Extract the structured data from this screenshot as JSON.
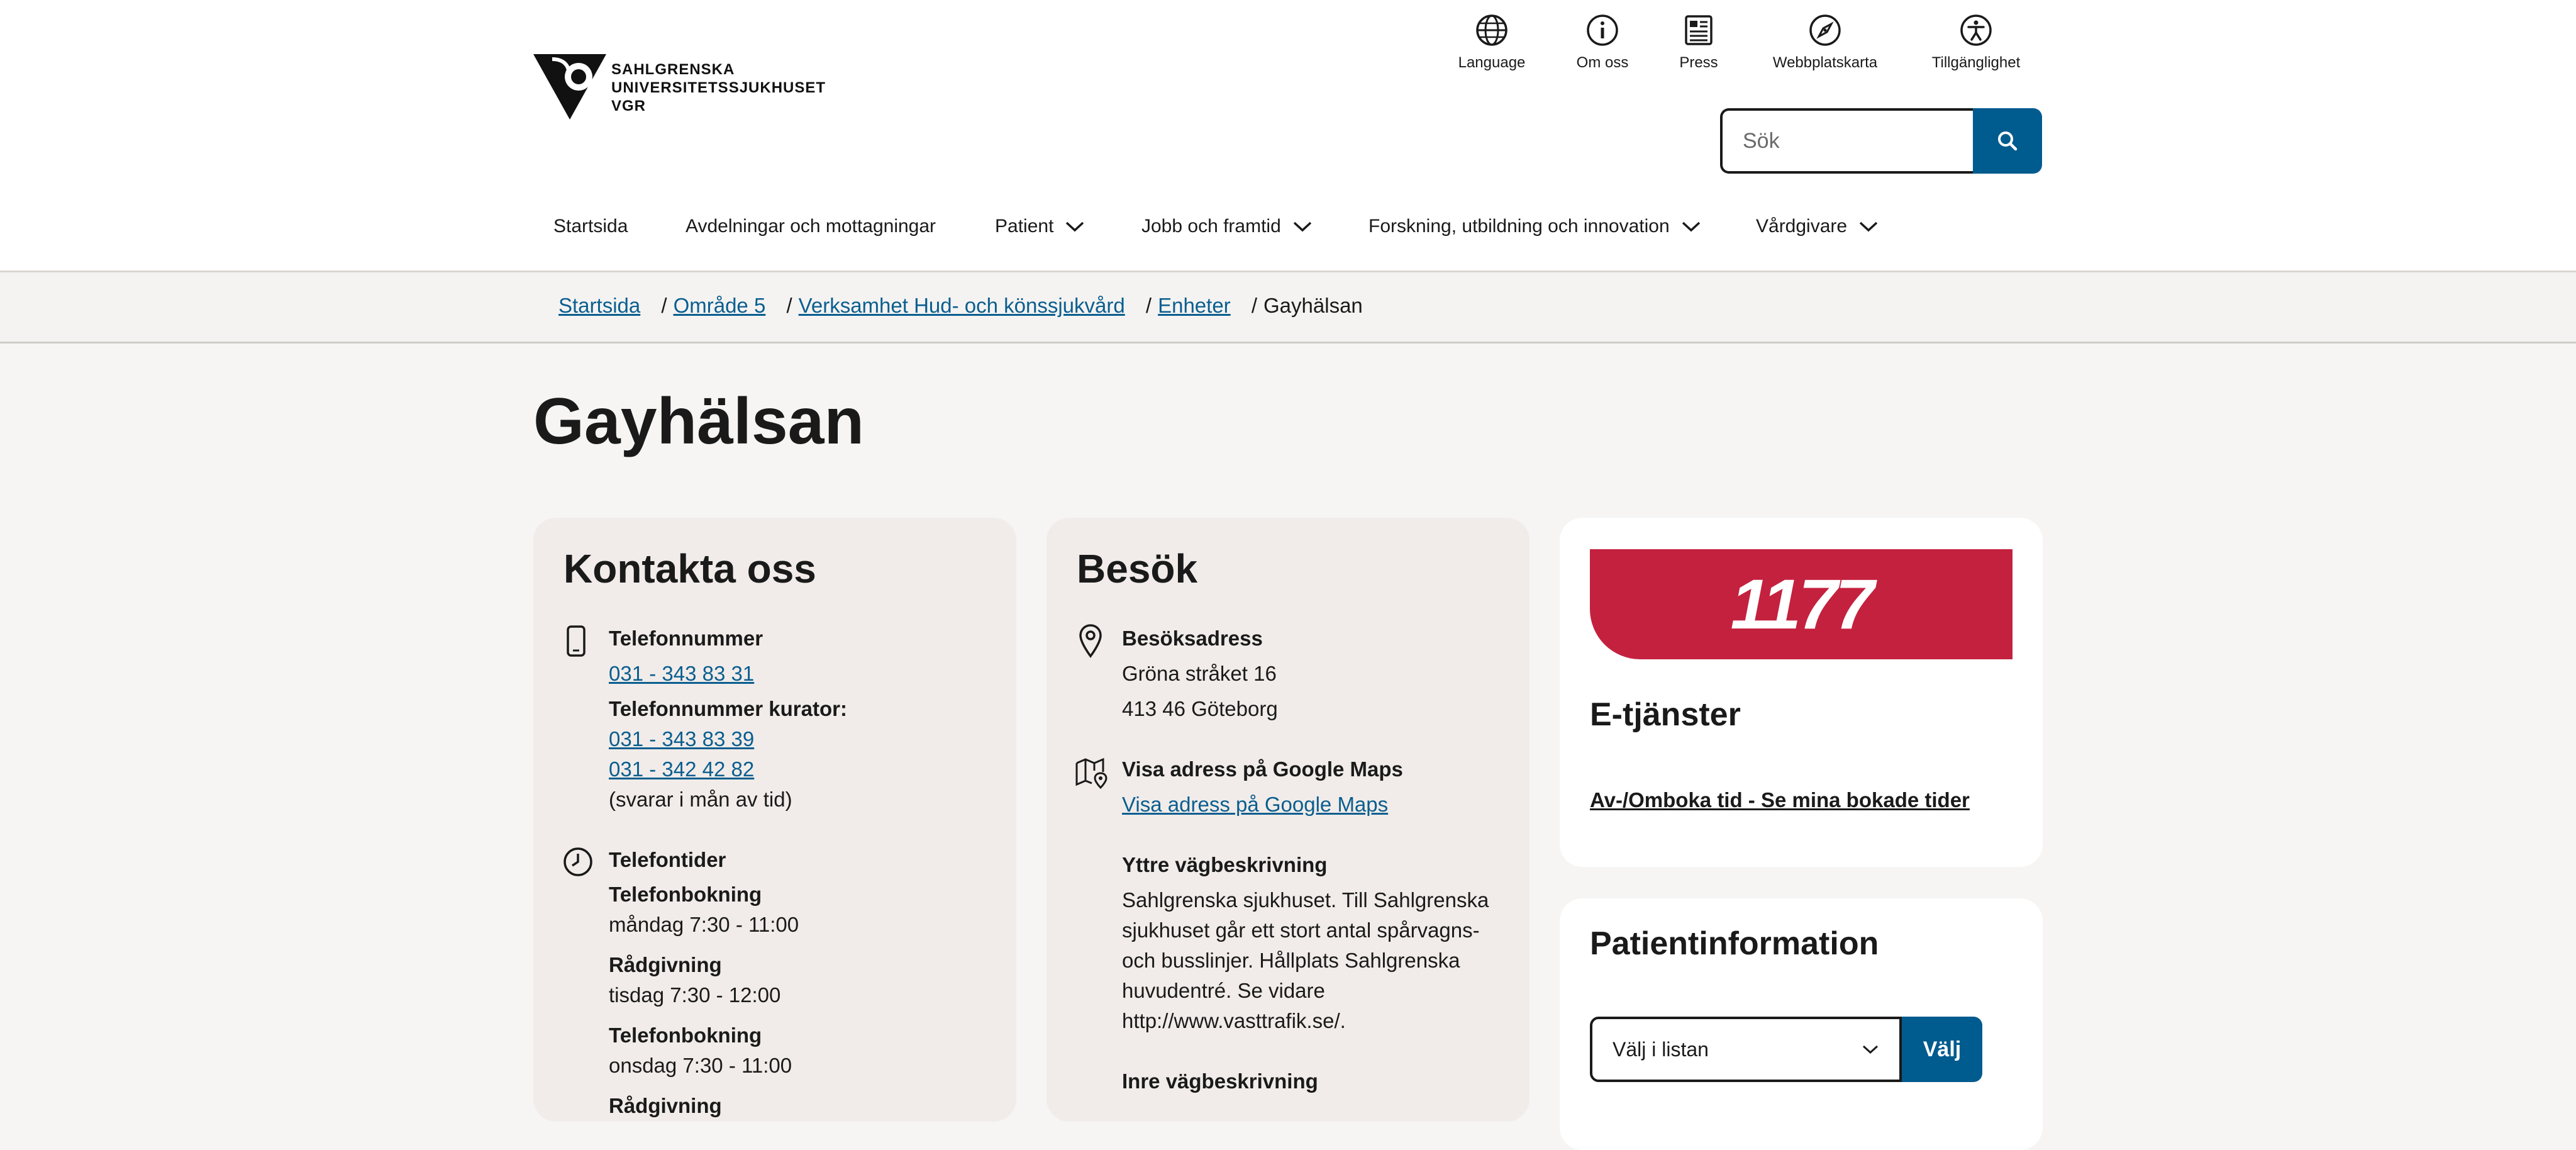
{
  "header": {
    "logo_text_lines": [
      "SAHLGRENSKA",
      "UNIVERSITETSSJUKHUSET",
      "VGR"
    ],
    "utility_nav": [
      {
        "label": "Language",
        "icon": "globe-icon"
      },
      {
        "label": "Om oss",
        "icon": "info-icon"
      },
      {
        "label": "Press",
        "icon": "newspaper-icon"
      },
      {
        "label": "Webbplatskarta",
        "icon": "compass-icon"
      },
      {
        "label": "Tillgänglighet",
        "icon": "accessibility-icon"
      }
    ],
    "search": {
      "placeholder": "Sök"
    },
    "main_nav": [
      {
        "label": "Startsida"
      },
      {
        "label": "Avdelningar och mottagningar"
      },
      {
        "label": "Patient"
      },
      {
        "label": "Jobb och framtid"
      },
      {
        "label": "Forskning, utbildning och innovation"
      },
      {
        "label": "Vårdgivare"
      }
    ]
  },
  "breadcrumb": [
    {
      "label": "Startsida"
    },
    {
      "label": "Område 5"
    },
    {
      "label": "Verksamhet Hud- och könssjukvård"
    },
    {
      "label": "Enheter"
    },
    {
      "label": "Gayhälsan"
    }
  ],
  "page_title": "Gayhälsan",
  "contact": {
    "title": "Kontakta oss",
    "phone_label": "Telefonnummer",
    "phone": "031 - 343 83 31",
    "curator_label": "Telefonnummer kurator:",
    "curator_phone_1": "031 - 343 83 39",
    "curator_phone_2": "031 - 342 42 82",
    "curator_note": "(svarar i mån av tid)",
    "hours_label": "Telefontider",
    "hours": [
      {
        "title": "Telefonbokning",
        "time": "måndag 7:30 - 11:00"
      },
      {
        "title": "Rådgivning",
        "time": "tisdag 7:30 - 12:00"
      },
      {
        "title": "Telefonbokning",
        "time": "onsdag 7:30 - 11:00"
      },
      {
        "title": "Rådgivning",
        "time": ""
      }
    ]
  },
  "visit": {
    "title": "Besök",
    "address_label": "Besöksadress",
    "street": "Gröna stråket 16",
    "city": "413 46 Göteborg",
    "maps_label": "Visa adress på Google Maps",
    "maps_link": "Visa adress på Google Maps",
    "outer_label": "Yttre vägbeskrivning",
    "outer_lines": [
      "Sahlgrenska sjukhuset. Till Sahlgrenska",
      "sjukhuset går ett stort antal spårvagns-",
      "och busslinjer. Hållplats Sahlgrenska",
      "huvudentré. Se vidare",
      "http://www.vasttrafik.se/."
    ],
    "inner_label": "Inre vägbeskrivning"
  },
  "eservices": {
    "logo_text": "1177",
    "title": "E-tjänster",
    "link": "Av-/Omboka tid - Se mina bokade tider"
  },
  "patientinfo": {
    "title": "Patientinformation",
    "select_value": "Välj i listan",
    "button": "Välj"
  },
  "colors": {
    "brand_blue": "#005b8f",
    "link_blue": "#0a5e8f",
    "brand_red_1177": "#c4213f",
    "card_beige": "#f1ece9",
    "page_bg": "#f6f5f4"
  }
}
